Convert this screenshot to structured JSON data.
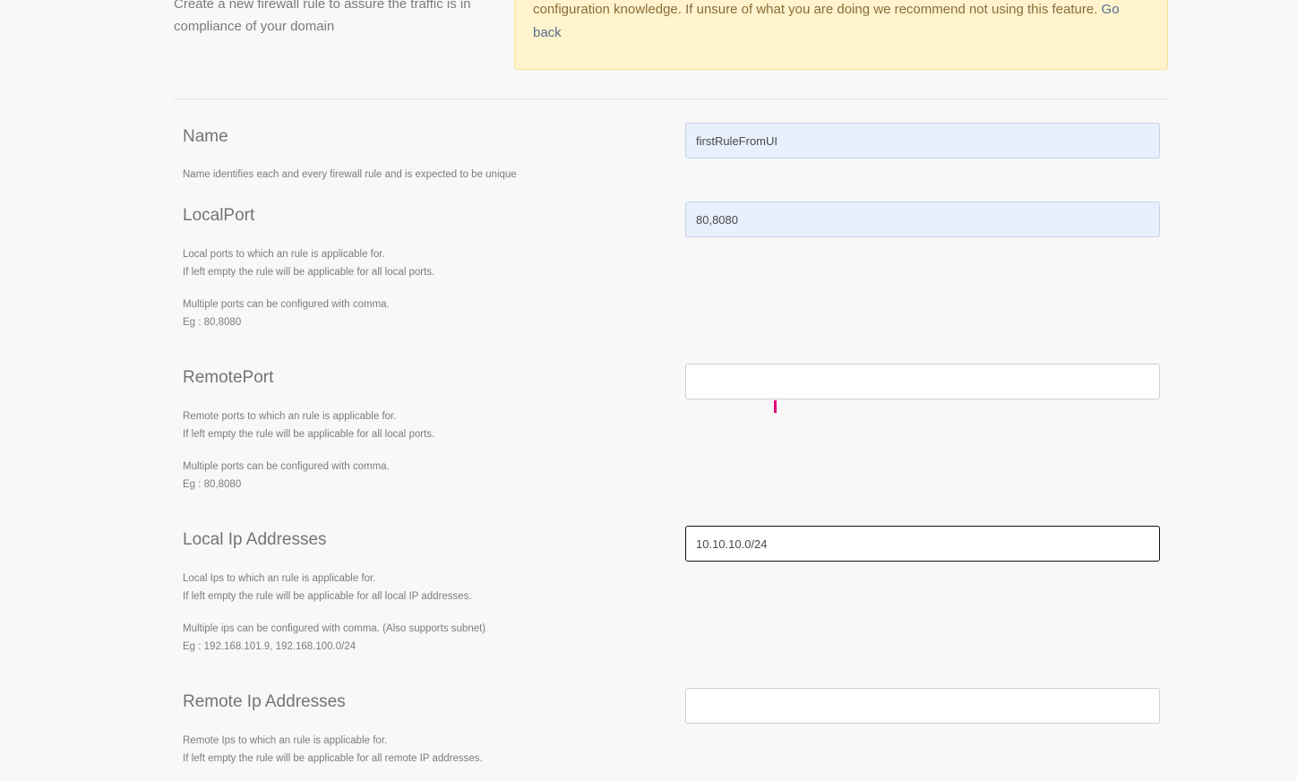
{
  "intro": {
    "text": "Create a new firewall rule to assure the traffic is in compliance of your domain"
  },
  "warning": {
    "text": "configuration knowledge. If unsure of what you are doing we recommend not using this feature.",
    "link_label": "Go back"
  },
  "fields": {
    "name": {
      "title": "Name",
      "value": "firstRuleFromUI",
      "desc1": "Name identifies each and every firewall rule and is expected to be unique"
    },
    "local_port": {
      "title": "LocalPort",
      "value": "80,8080",
      "desc1": "Local ports to which an rule is applicable for.",
      "desc2": "If left empty the rule will be applicable for all local ports.",
      "desc3": "Multiple ports can be configured with comma.",
      "desc4": "Eg : 80,8080"
    },
    "remote_port": {
      "title": "RemotePort",
      "value": "",
      "desc1": "Remote ports to which an rule is applicable for.",
      "desc2": "If left empty the rule will be applicable for all local ports.",
      "desc3": "Multiple ports can be configured with comma.",
      "desc4": "Eg : 80,8080"
    },
    "local_ip": {
      "title": "Local Ip Addresses",
      "value": "10.10.10.0/24",
      "desc1": "Local Ips to which an rule is applicable for.",
      "desc2": "If left empty the rule will be applicable for all local IP addresses.",
      "desc3": "Multiple ips can be configured with comma. (Also supports subnet)",
      "desc4": "Eg : 192.168.101.9, 192.168.100.0/24"
    },
    "remote_ip": {
      "title": "Remote Ip Addresses",
      "value": "",
      "desc1": "Remote Ips to which an rule is applicable for.",
      "desc2": "If left empty the rule will be applicable for all remote IP addresses."
    }
  },
  "colors": {
    "page_bg": "#f8f8f8",
    "warning_bg": "#fff4cd",
    "autofill_bg": "#e8f0fe",
    "cursor_marker": "#e2007a"
  }
}
